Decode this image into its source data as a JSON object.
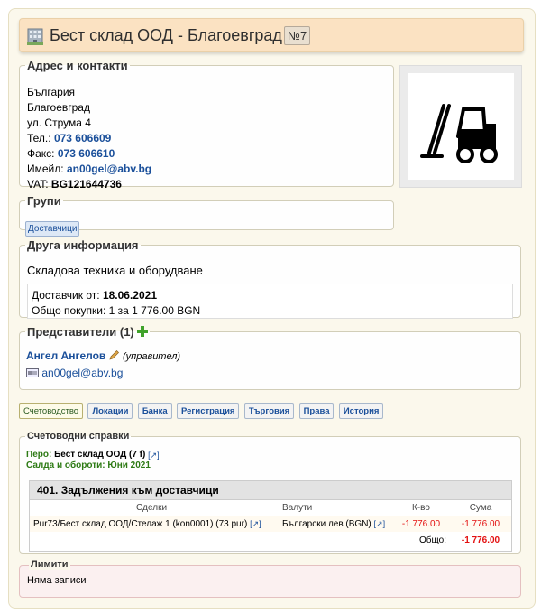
{
  "header": {
    "title": "Бест склад ООД - Благоевград",
    "number": "№7",
    "icon": "building-icon"
  },
  "address": {
    "legend": "Адрес и контакти",
    "country": "България",
    "city": "Благоевград",
    "street": "ул. Струма 4",
    "phone_label": "Тел.:",
    "phone": "073 606609",
    "fax_label": "Факс:",
    "fax": "073 606610",
    "email_label": "Имейл:",
    "email": "an00gel@abv.bg",
    "vat_label": "VAT:",
    "vat": "BG121644736"
  },
  "image": {
    "icon": "forklift-icon"
  },
  "groups": {
    "legend": "Групи",
    "items": [
      "Доставчици"
    ]
  },
  "other_info": {
    "legend": "Друга информация",
    "description": "Складова техника и оборудване",
    "supplier_since_label": "Доставчик от:",
    "supplier_since": "18.06.2021",
    "purchases_label": "Общо покупки:",
    "purchases": "1 за 1 776.00 BGN"
  },
  "representatives": {
    "legend": "Представители (1)",
    "name": "Ангел Ангелов",
    "role": "(управител)",
    "email": "an00gel@abv.bg"
  },
  "tabs": [
    {
      "label": "Счетоводство",
      "active": true
    },
    {
      "label": "Локации"
    },
    {
      "label": "Банка"
    },
    {
      "label": "Регистрация"
    },
    {
      "label": "Търговия"
    },
    {
      "label": "Права"
    },
    {
      "label": "История"
    }
  ],
  "accounting": {
    "legend": "Счетоводни справки",
    "pero_label": "Перо:",
    "pero": "Бест склад ООД (7 f)",
    "period": "Салда и обороти: Юни 2021",
    "report": {
      "title": "401. Задължения към доставчици",
      "columns": [
        "Сделки",
        "Валути",
        "К-во",
        "Сума"
      ],
      "row": {
        "deal": "Pur73/Бест склад ООД/Стелаж 1 (kon0001) (73 pur)",
        "currency": "Български лев (BGN)",
        "qty": "-1 776.00",
        "sum": "-1 776.00"
      },
      "total_label": "Общо:",
      "total": "-1 776.00"
    }
  },
  "limits": {
    "legend": "Лимити",
    "empty": "Няма записи"
  },
  "ext_link_glyph": "[↗]"
}
